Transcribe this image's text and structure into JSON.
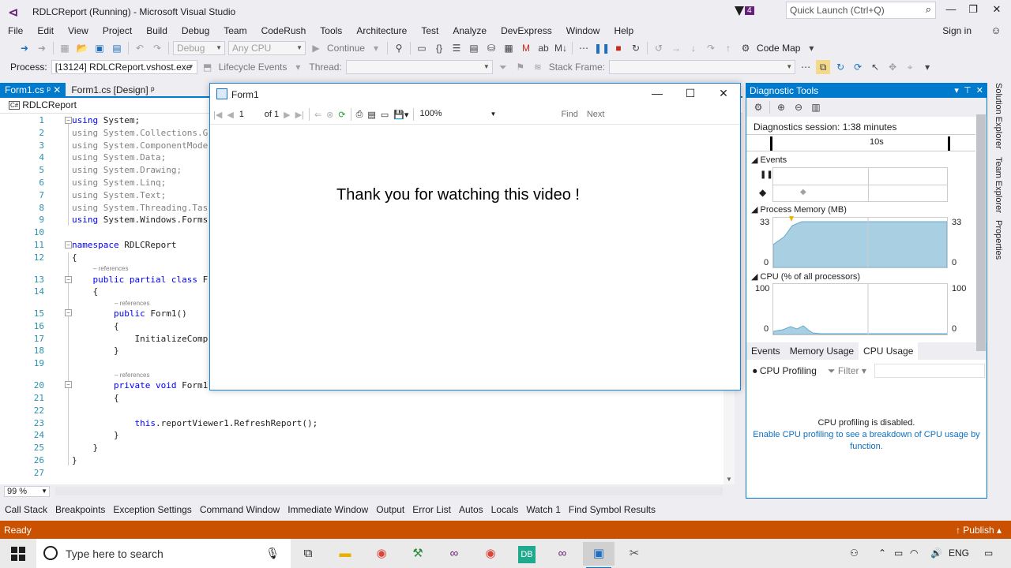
{
  "window": {
    "title": "RDLCReport (Running) - Microsoft Visual Studio",
    "notification_count": "4",
    "quick_launch_placeholder": "Quick Launch (Ctrl+Q)",
    "sign_in": "Sign in"
  },
  "menu": [
    "File",
    "Edit",
    "View",
    "Project",
    "Build",
    "Debug",
    "Team",
    "CodeRush",
    "Tools",
    "Architecture",
    "Test",
    "Analyze",
    "DevExpress",
    "Window",
    "Help"
  ],
  "toolbar1": {
    "config": "Debug",
    "platform": "Any CPU",
    "continue": "Continue",
    "code_map": "Code Map"
  },
  "toolbar2": {
    "process_label": "Process:",
    "process_value": "[13124] RDLCReport.vshost.exe",
    "lifecycle": "Lifecycle Events",
    "thread_label": "Thread:",
    "stack_frame_label": "Stack Frame:"
  },
  "doc_tabs": [
    "Form1.cs",
    "Form1.cs [Design]"
  ],
  "nav_project": "RDLCReport",
  "editor": {
    "zoom": "99 %",
    "references": "– references",
    "lines": [
      {
        "n": "1",
        "t": "using System;"
      },
      {
        "n": "2",
        "t": "using System.Collections.G"
      },
      {
        "n": "3",
        "t": "using System.ComponentMode"
      },
      {
        "n": "4",
        "t": "using System.Data;"
      },
      {
        "n": "5",
        "t": "using System.Drawing;"
      },
      {
        "n": "6",
        "t": "using System.Linq;"
      },
      {
        "n": "7",
        "t": "using System.Text;"
      },
      {
        "n": "8",
        "t": "using System.Threading.Tas"
      },
      {
        "n": "9",
        "t": "using System.Windows.Forms"
      },
      {
        "n": "10",
        "t": ""
      },
      {
        "n": "11",
        "t": "namespace RDLCReport"
      },
      {
        "n": "12",
        "t": "{"
      },
      {
        "n": "13",
        "t": "    public partial class F"
      },
      {
        "n": "14",
        "t": "    {"
      },
      {
        "n": "15",
        "t": "        public Form1()"
      },
      {
        "n": "16",
        "t": "        {"
      },
      {
        "n": "17",
        "t": "            InitializeComp"
      },
      {
        "n": "18",
        "t": "        }"
      },
      {
        "n": "19",
        "t": ""
      },
      {
        "n": "20",
        "t": "        private void Form1"
      },
      {
        "n": "21",
        "t": "        {"
      },
      {
        "n": "22",
        "t": ""
      },
      {
        "n": "23",
        "t": "            this.reportViewer1.RefreshReport();"
      },
      {
        "n": "24",
        "t": "        }"
      },
      {
        "n": "25",
        "t": "    }"
      },
      {
        "n": "26",
        "t": "}"
      },
      {
        "n": "27",
        "t": ""
      }
    ]
  },
  "form1": {
    "title": "Form1",
    "page": "1",
    "of_label": "of 1",
    "zoom": "100%",
    "find": "Find",
    "next": "Next",
    "message": "Thank you for watching this video !"
  },
  "diagnostics": {
    "title": "Diagnostic Tools",
    "session": "Diagnostics session: 1:38 minutes",
    "timeline_label": "10s",
    "events_label": "Events",
    "memory_label": "Process Memory (MB)",
    "memory_max": "33",
    "memory_min": "0",
    "cpu_label": "CPU (% of all processors)",
    "cpu_max": "100",
    "cpu_min": "0",
    "tabs": [
      "Events",
      "Memory Usage",
      "CPU Usage"
    ],
    "cpu_profiling": "CPU Profiling",
    "filter": "Filter",
    "disabled_text": "CPU profiling is disabled.",
    "enable_link": "Enable CPU profiling to see a breakdown of CPU usage by function."
  },
  "side_tabs": [
    "Solution Explorer",
    "Team Explorer",
    "Properties"
  ],
  "bottom_tabs": [
    "Call Stack",
    "Breakpoints",
    "Exception Settings",
    "Command Window",
    "Immediate Window",
    "Output",
    "Error List",
    "Autos",
    "Locals",
    "Watch 1",
    "Find Symbol Results"
  ],
  "status": {
    "ready": "Ready",
    "publish": "↑ Publish ▴"
  },
  "taskbar": {
    "search_placeholder": "Type here to search",
    "language": "ENG"
  },
  "colors": {
    "accent": "#007acc",
    "status_bar": "#ca5100",
    "vs_purple": "#68217a"
  }
}
